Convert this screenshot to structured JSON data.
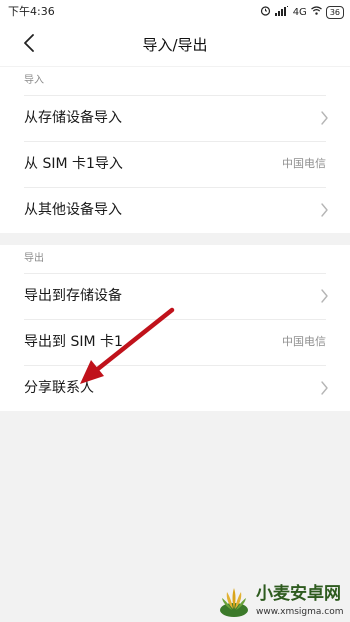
{
  "status_bar": {
    "time": "下午4:36",
    "network": "4G",
    "battery": "36"
  },
  "header": {
    "title": "导入/导出"
  },
  "import_section": {
    "title": "导入",
    "items": [
      {
        "label": "从存储设备导入"
      },
      {
        "label": "从 SIM 卡1导入",
        "value": "中国电信"
      },
      {
        "label": "从其他设备导入"
      }
    ]
  },
  "export_section": {
    "title": "导出",
    "items": [
      {
        "label": "导出到存储设备"
      },
      {
        "label": "导出到 SIM 卡1",
        "value": "中国电信"
      },
      {
        "label": "分享联系人"
      }
    ]
  },
  "watermark": {
    "brand": "小麦安卓网",
    "site": "www.xmsigma.com"
  },
  "colors": {
    "page_bg": "#f2f2f2",
    "card_bg": "#ffffff",
    "annotation_arrow": "#c0121b",
    "brand_green": "#2e5b1f"
  },
  "icons": {
    "back": "chevron-left-icon",
    "row_arrow": "chevron-right-icon"
  }
}
